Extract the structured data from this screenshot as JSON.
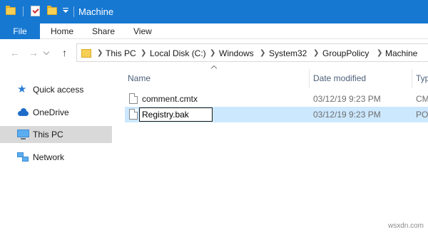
{
  "window": {
    "title": "Machine"
  },
  "ribbon": {
    "tabs": [
      "File",
      "Home",
      "Share",
      "View"
    ]
  },
  "address": {
    "crumbs": [
      "This PC",
      "Local Disk (C:)",
      "Windows",
      "System32",
      "GroupPolicy",
      "Machine"
    ]
  },
  "sidebar": {
    "items": [
      {
        "label": "Quick access",
        "icon": "star-icon"
      },
      {
        "label": "OneDrive",
        "icon": "cloud-icon"
      },
      {
        "label": "This PC",
        "icon": "computer-icon",
        "selected": true
      },
      {
        "label": "Network",
        "icon": "network-icon"
      }
    ]
  },
  "files": {
    "columns": [
      "Name",
      "Date modified",
      "Typ"
    ],
    "rows": [
      {
        "name": "comment.cmtx",
        "date": "03/12/19 9:23 PM",
        "type": "CM"
      },
      {
        "name": "Registry.bak",
        "date": "03/12/19 9:23 PM",
        "type": "PO",
        "selected": true,
        "renaming": true
      }
    ]
  },
  "watermark": "wsxdn.com",
  "colors": {
    "accent": "#1778d2",
    "selection": "#cce8ff",
    "sidebar_selected": "#d9d9d9"
  }
}
